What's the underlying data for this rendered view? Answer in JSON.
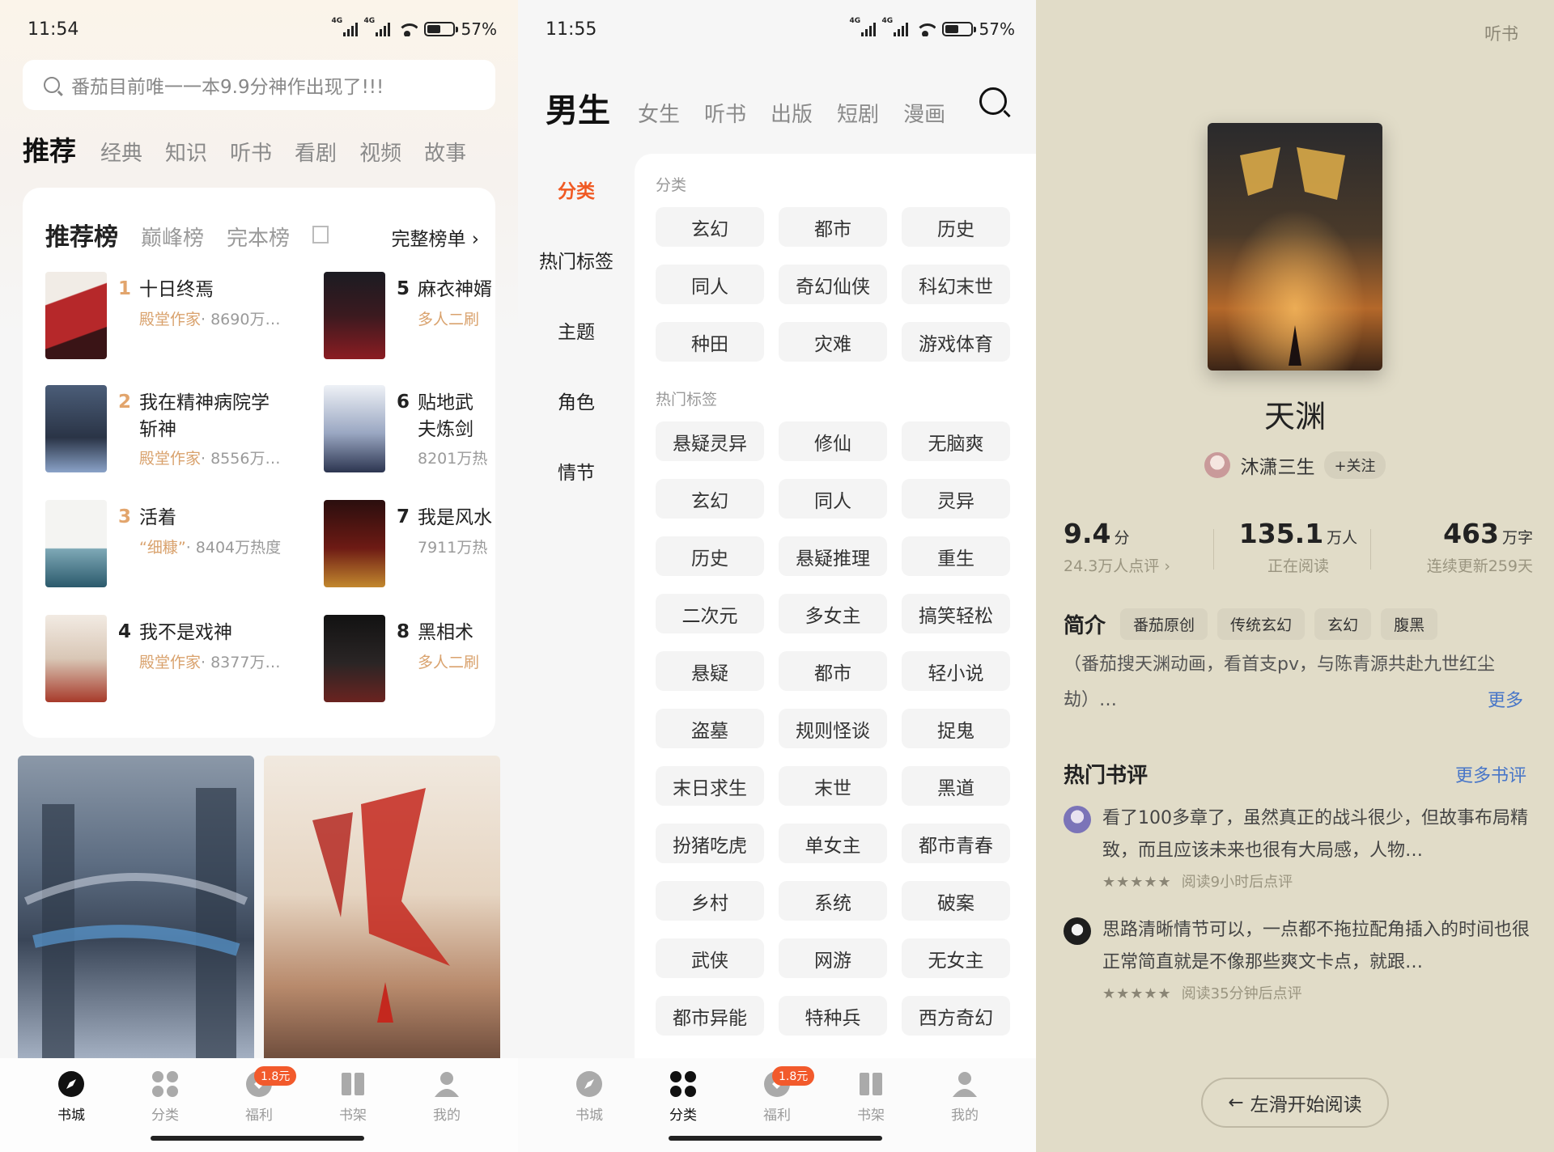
{
  "screen1": {
    "status": {
      "time": "11:54",
      "battery": "57%"
    },
    "search_placeholder": "番茄目前唯一一本9.9分神作出现了!!!",
    "tabs": [
      "推荐",
      "经典",
      "知识",
      "听书",
      "看剧",
      "视频",
      "故事"
    ],
    "rank_tabs": [
      "推荐榜",
      "巅峰榜",
      "完本榜"
    ],
    "full_list": "完整榜单",
    "ranks": [
      {
        "num": "1",
        "title": "十日终焉",
        "author": "殿堂作家",
        "heat": "· 8690万…"
      },
      {
        "num": "2",
        "title": "我在精神病院学斩神",
        "author": "殿堂作家",
        "heat": "· 8556万…"
      },
      {
        "num": "3",
        "title": "活着",
        "author": "“细糠”",
        "heat": "· 8404万热度"
      },
      {
        "num": "4",
        "title": "我不是戏神",
        "author": "殿堂作家",
        "heat": "· 8377万…"
      },
      {
        "num": "5",
        "title": "麻衣神婿",
        "author": "多人二刷",
        "heat": ""
      },
      {
        "num": "6",
        "title": "贴地武夫炼剑起飞",
        "author": "",
        "heat": "8201万热"
      },
      {
        "num": "7",
        "title": "我是风水",
        "author": "",
        "heat": "7911万热"
      },
      {
        "num": "8",
        "title": "黑相术",
        "author": "多人二刷",
        "heat": ""
      }
    ],
    "nav": [
      {
        "label": "书城",
        "icon": "compass-icon"
      },
      {
        "label": "分类",
        "icon": "grid-icon"
      },
      {
        "label": "福利",
        "icon": "gift-icon",
        "badge": "1.8元"
      },
      {
        "label": "书架",
        "icon": "bookshelf-icon"
      },
      {
        "label": "我的",
        "icon": "user-icon"
      }
    ]
  },
  "screen2": {
    "status": {
      "time": "11:55",
      "battery": "57%"
    },
    "tabs": [
      "男生",
      "女生",
      "听书",
      "出版",
      "短剧",
      "漫画"
    ],
    "side": [
      "分类",
      "热门标签",
      "主题",
      "角色",
      "情节"
    ],
    "section1_title": "分类",
    "section1": [
      "玄幻",
      "都市",
      "历史",
      "同人",
      "奇幻仙侠",
      "科幻末世",
      "种田",
      "灾难",
      "游戏体育"
    ],
    "section2_title": "热门标签",
    "section2": [
      "悬疑灵异",
      "修仙",
      "无脑爽",
      "玄幻",
      "同人",
      "灵异",
      "历史",
      "悬疑推理",
      "重生",
      "二次元",
      "多女主",
      "搞笑轻松",
      "悬疑",
      "都市",
      "轻小说",
      "盗墓",
      "规则怪谈",
      "捉鬼",
      "末日求生",
      "末世",
      "黑道",
      "扮猪吃虎",
      "单女主",
      "都市青春",
      "乡村",
      "系统",
      "破案",
      "武侠",
      "网游",
      "无女主",
      "都市异能",
      "特种兵",
      "西方奇幻"
    ],
    "nav": [
      {
        "label": "书城"
      },
      {
        "label": "分类"
      },
      {
        "label": "福利",
        "badge": "1.8元"
      },
      {
        "label": "书架"
      },
      {
        "label": "我的"
      }
    ]
  },
  "screen3": {
    "listen": "听书",
    "book_title": "天渊",
    "author": "沐潇三生",
    "follow": "+关注",
    "rating": "9.4",
    "rating_unit": "分",
    "rating_sub": "24.3万人点评 ›",
    "readers": "135.1",
    "readers_unit": "万人",
    "readers_sub": "正在阅读",
    "words": "463",
    "words_unit": "万字",
    "words_sub": "连续更新259天",
    "intro_label": "简介",
    "tags": [
      "番茄原创",
      "传统玄幻",
      "玄幻",
      "腹黑"
    ],
    "intro": "（番茄搜天渊动画，看首支pv，与陈青源共赴九世红尘劫）…",
    "more": "更多",
    "reviews_label": "热门书评",
    "more_reviews": "更多书评",
    "reviews": [
      {
        "text": "看了100多章了，虽然真正的战斗很少，但故事布局精致，而且应该未来也很有大局感，人物…",
        "stars": "★★★★★",
        "meta": "阅读9小时后点评"
      },
      {
        "text": "思路清晰情节可以，一点都不拖拉配角插入的时间也很正常简直就是不像那些爽文卡点，就跟…",
        "stars": "★★★★★",
        "meta": "阅读35分钟后点评"
      }
    ],
    "start": "左滑开始阅读"
  },
  "colors": {
    "accent_orange": "#f05a24",
    "rank_gold": "#e2a56d",
    "link_blue": "#4876c8",
    "badge": "#f25a2c"
  }
}
